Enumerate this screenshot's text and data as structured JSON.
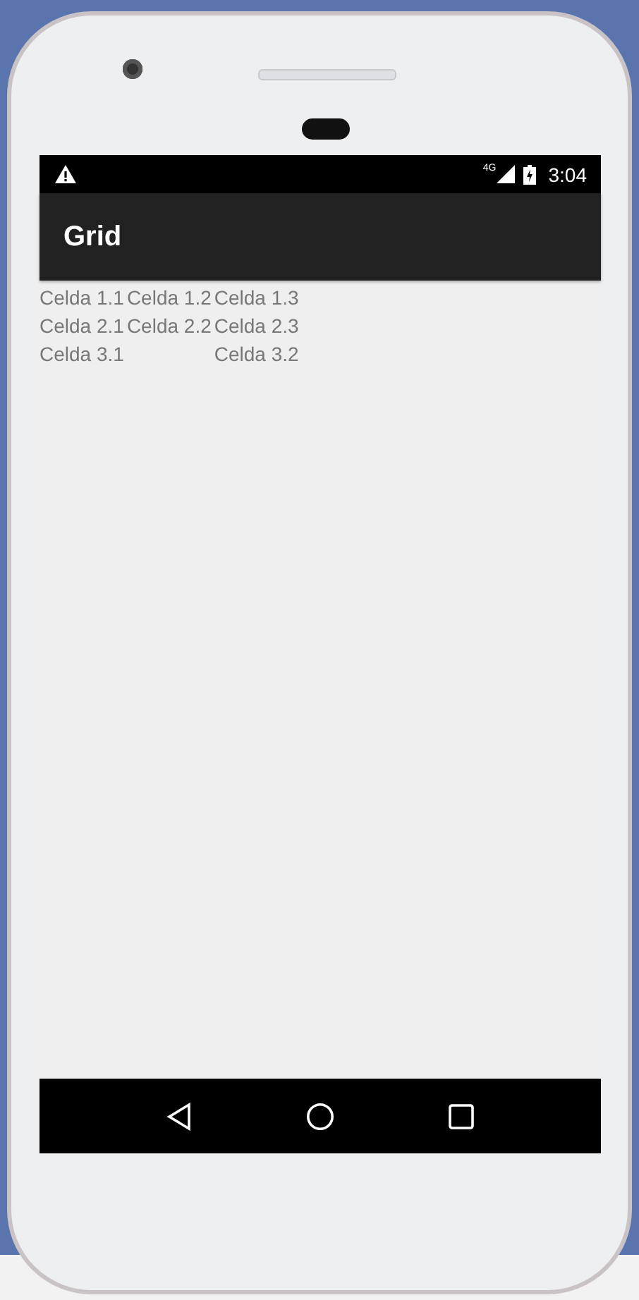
{
  "status_bar": {
    "network": "4G",
    "time": "3:04"
  },
  "app_bar": {
    "title": "Grid"
  },
  "grid": {
    "rows": [
      [
        "Celda 1.1",
        "Celda 1.2",
        "Celda 1.3"
      ],
      [
        "Celda 2.1",
        "Celda 2.2",
        "Celda 2.3"
      ],
      [
        "Celda 3.1",
        null,
        "Celda 3.2"
      ]
    ]
  }
}
